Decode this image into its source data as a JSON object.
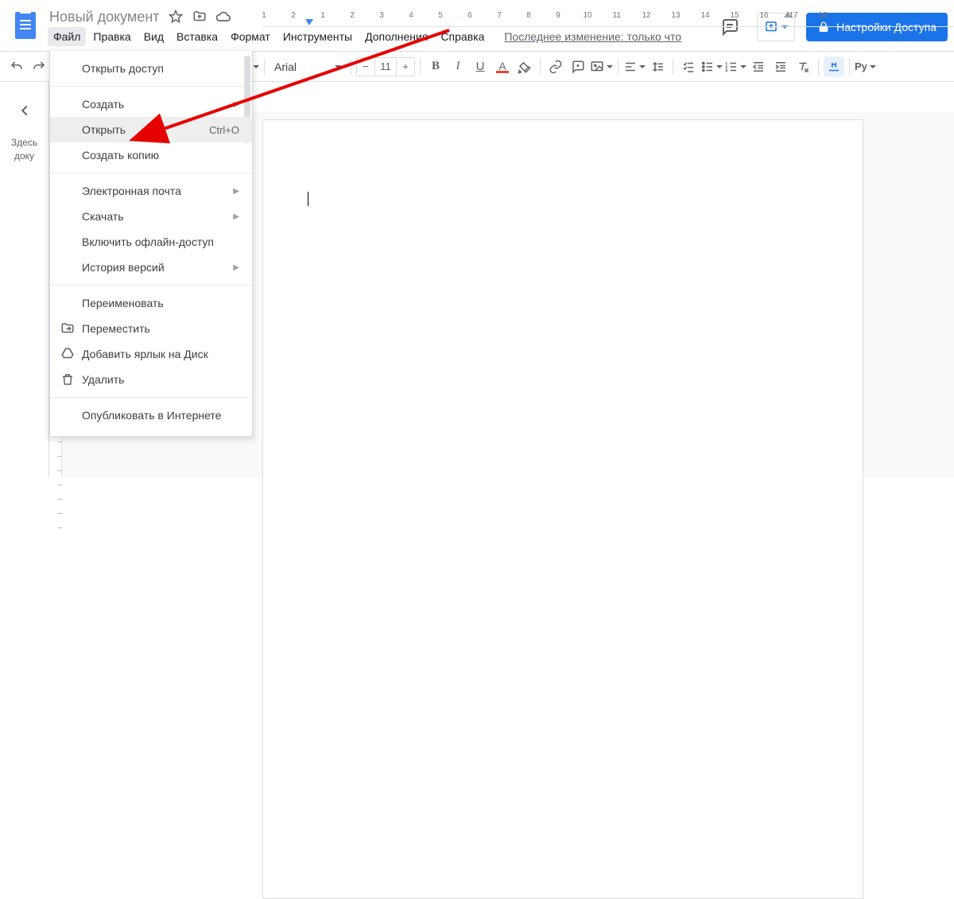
{
  "header": {
    "doc_title": "Новый документ",
    "last_edit": "Последнее изменение: только что",
    "share_label": "Настройки Доступа"
  },
  "menubar": {
    "items": [
      "Файл",
      "Правка",
      "Вид",
      "Вставка",
      "Формат",
      "Инструменты",
      "Дополнения",
      "Справка"
    ],
    "active_index": 0
  },
  "toolbar": {
    "font_name": "Arial",
    "font_size": "11",
    "zoom_hint": "",
    "editing_label": "Ру"
  },
  "left_panel": {
    "line1": "Здесь",
    "line2": "доку"
  },
  "file_menu": {
    "groups": [
      [
        {
          "label": "Открыть доступ"
        }
      ],
      [
        {
          "label": "Создать",
          "submenu": true
        },
        {
          "label": "Открыть",
          "shortcut": "Ctrl+O",
          "highlight": true
        },
        {
          "label": "Создать копию"
        }
      ],
      [
        {
          "label": "Электронная почта",
          "submenu": true
        },
        {
          "label": "Скачать",
          "submenu": true
        },
        {
          "label": "Включить офлайн-доступ"
        },
        {
          "label": "История версий",
          "submenu": true
        }
      ],
      [
        {
          "label": "Переименовать"
        },
        {
          "label": "Переместить",
          "icon": "move"
        },
        {
          "label": "Добавить ярлык на Диск",
          "icon": "drive"
        },
        {
          "label": "Удалить",
          "icon": "trash"
        }
      ],
      [
        {
          "label": "Опубликовать в Интернете"
        }
      ]
    ]
  },
  "ruler": {
    "numbers": [
      "1",
      "2",
      "1",
      "2",
      "3",
      "4",
      "5",
      "6",
      "7",
      "8",
      "9",
      "10",
      "11",
      "12",
      "13",
      "14",
      "15",
      "16",
      "17",
      "18"
    ]
  }
}
